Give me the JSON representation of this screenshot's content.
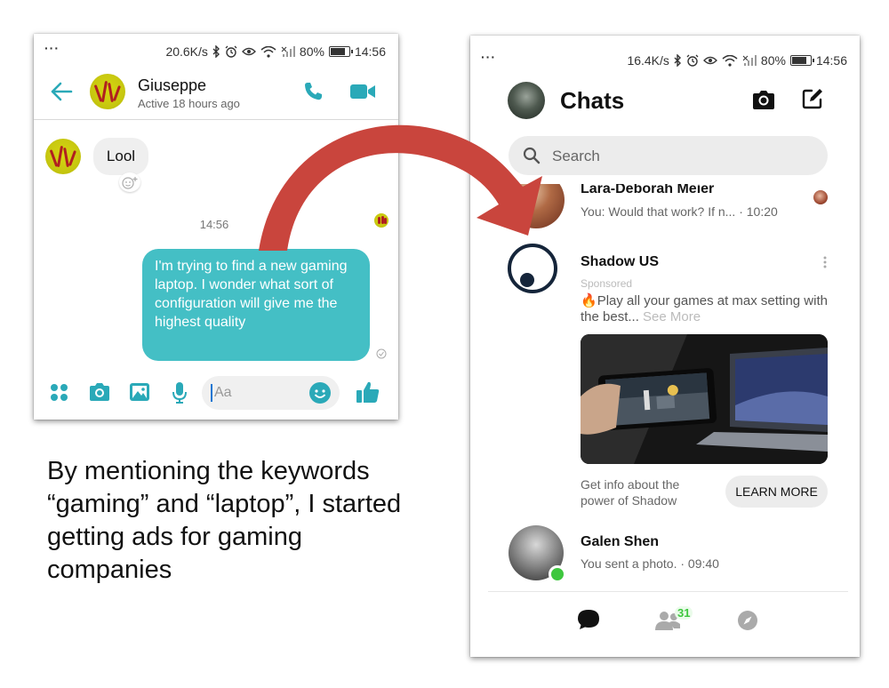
{
  "left_phone": {
    "status_bar": {
      "speed": "20.6K/s",
      "battery": "80%",
      "time": "14:56"
    },
    "contact_name": "Giuseppe",
    "contact_status": "Active 18 hours ago",
    "messages": {
      "incoming_text": "Lool",
      "timestamp": "14:56",
      "outgoing_text": "I'm trying to find a new gaming laptop. I wonder what sort of configuration will give me the highest quality"
    },
    "composer_placeholder": "Aa"
  },
  "right_phone": {
    "status_bar": {
      "speed": "16.4K/s",
      "battery": "80%",
      "time": "14:56"
    },
    "title": "Chats",
    "search_placeholder": "Search",
    "chats": [
      {
        "name": "Lara-Deborah Meier",
        "preview": "You: Would that work? If n... · 10:20"
      },
      {
        "name": "Galen Shen",
        "preview": "You sent a photo. · 09:40"
      }
    ],
    "ad": {
      "name": "Shadow US",
      "sponsored": "Sponsored",
      "text": "Play all your games at max setting with the best...",
      "see_more": "See More",
      "cta_text": "Get info about the power of Shadow",
      "cta_button": "LEARN MORE"
    },
    "people_badge": "31"
  },
  "caption": "By mentioning the keywords “gaming” and “laptop”, I started getting ads for gaming companies",
  "colors": {
    "accent": "#2aa9b8",
    "bubble": "#44bfc5",
    "arrow": "#c9453d",
    "online": "#3ec73e"
  }
}
